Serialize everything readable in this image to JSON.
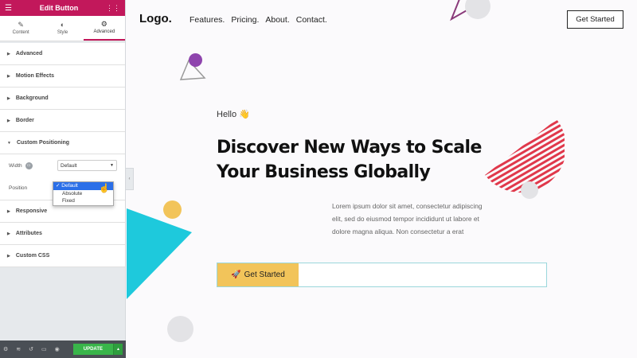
{
  "panel": {
    "title": "Edit Button",
    "tabs": [
      {
        "label": "Content",
        "icon": "pencil-icon"
      },
      {
        "label": "Style",
        "icon": "half-circle-icon"
      },
      {
        "label": "Advanced",
        "icon": "gear-icon"
      }
    ],
    "active_tab": "Advanced",
    "sections_top": [
      "Advanced",
      "Motion Effects",
      "Background",
      "Border"
    ],
    "custom_positioning": {
      "label": "Custom Positioning",
      "width_label": "Width",
      "width_value": "Default",
      "position_label": "Position",
      "position_options": [
        "Default",
        "Absolute",
        "Fixed"
      ],
      "position_selected": "Default"
    },
    "sections_bottom": [
      "Responsive",
      "Attributes",
      "Custom CSS"
    ],
    "update_label": "UPDATE"
  },
  "site": {
    "logo": "Logo.",
    "nav": [
      "Features.",
      "Pricing.",
      "About.",
      "Contact."
    ],
    "header_button": "Get Started",
    "hello": "Hello 👋",
    "headline": "Discover New Ways to Scale Your Business Globally",
    "body": "Lorem ipsum dolor sit amet, consectetur adipiscing elit, sed do eiusmod tempor incididunt ut labore et dolore magna aliqua. Non consectetur a erat",
    "cta_label": "Get Started",
    "cta_icon": "🚀"
  },
  "colors": {
    "brand": "#c2185b",
    "update_green": "#39b54a",
    "cta_yellow": "#f2c45a",
    "accent_cyan": "#1ec9dc",
    "stripe_red": "#e0384b",
    "dot_purple": "#8e44ad"
  }
}
